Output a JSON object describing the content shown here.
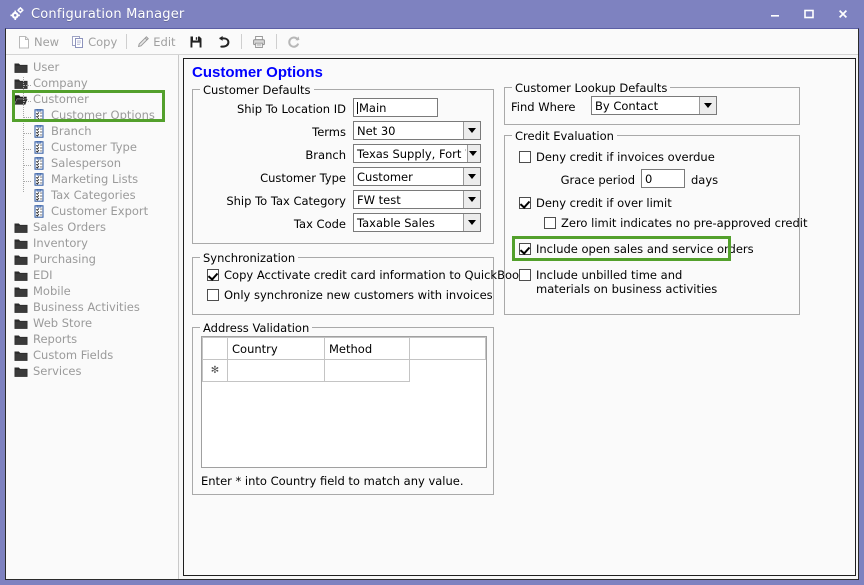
{
  "window": {
    "title": "Configuration Manager",
    "icon": "gear-icon",
    "minimize_label": "–",
    "maximize_label": "☐",
    "close_label": "✕",
    "titlebar_color": "#7e82c0"
  },
  "toolbar": {
    "items": [
      {
        "label": "New",
        "icon": "new-document-icon"
      },
      {
        "label": "Copy",
        "icon": "copy-icon"
      },
      {
        "label": "Edit",
        "icon": "pencil-edit-icon"
      },
      {
        "label": "",
        "icon": "save-disk-icon"
      },
      {
        "label": "",
        "icon": "undo-arrow-icon"
      },
      {
        "label": "",
        "icon": "print-icon"
      },
      {
        "label": "",
        "icon": "refresh-icon"
      }
    ]
  },
  "tree": {
    "items": [
      {
        "label": "User",
        "icon": "folder-icon",
        "level": 0
      },
      {
        "label": "Company",
        "icon": "folder-icon",
        "level": 0
      },
      {
        "label": "Customer",
        "icon": "folder-open-icon",
        "level": 0,
        "expanded": true
      },
      {
        "label": "Customer Options",
        "icon": "options-icon",
        "level": 1,
        "selected": true
      },
      {
        "label": "Branch",
        "icon": "options-icon",
        "level": 1
      },
      {
        "label": "Customer Type",
        "icon": "options-icon",
        "level": 1
      },
      {
        "label": "Salesperson",
        "icon": "options-icon",
        "level": 1
      },
      {
        "label": "Marketing Lists",
        "icon": "options-icon",
        "level": 1
      },
      {
        "label": "Tax Categories",
        "icon": "options-icon",
        "level": 1
      },
      {
        "label": "Customer Export",
        "icon": "options-icon",
        "level": 1
      },
      {
        "label": "Sales Orders",
        "icon": "folder-icon",
        "level": 0
      },
      {
        "label": "Inventory",
        "icon": "folder-icon",
        "level": 0
      },
      {
        "label": "Purchasing",
        "icon": "folder-icon",
        "level": 0
      },
      {
        "label": "EDI",
        "icon": "folder-icon",
        "level": 0
      },
      {
        "label": "Mobile",
        "icon": "folder-icon",
        "level": 0
      },
      {
        "label": "Business Activities",
        "icon": "folder-icon",
        "level": 0
      },
      {
        "label": "Web Store",
        "icon": "folder-icon",
        "level": 0
      },
      {
        "label": "Reports",
        "icon": "folder-icon",
        "level": 0
      },
      {
        "label": "Custom Fields",
        "icon": "folder-icon",
        "level": 0
      },
      {
        "label": "Services",
        "icon": "folder-icon",
        "level": 0
      }
    ],
    "highlight_color": "#53a02c"
  },
  "page": {
    "title": "Customer Options",
    "title_color": "#0000ff"
  },
  "customer_defaults": {
    "legend": "Customer Defaults",
    "ship_to_location_id": {
      "label": "Ship To Location ID",
      "value": "Main"
    },
    "terms": {
      "label": "Terms",
      "value": "Net 30"
    },
    "branch": {
      "label": "Branch",
      "value": "Texas Supply, Fort Worth"
    },
    "customer_type": {
      "label": "Customer Type",
      "value": "Customer"
    },
    "ship_to_tax_category": {
      "label": "Ship To Tax Category",
      "value": "FW test"
    },
    "tax_code": {
      "label": "Tax Code",
      "value": "Taxable Sales"
    }
  },
  "synchronization": {
    "legend": "Synchronization",
    "copy_credit_card": {
      "label": "Copy Acctivate credit card information to QuickBooks",
      "checked": true
    },
    "only_new_customers": {
      "label": "Only synchronize new customers with invoices",
      "checked": false
    }
  },
  "address_validation": {
    "legend": "Address Validation",
    "columns": [
      "",
      "Country",
      "Method",
      ""
    ],
    "rows": [
      {
        "marker": "✻",
        "country": "",
        "method": "",
        "extra": ""
      }
    ],
    "note": "Enter * into Country field to match any value."
  },
  "customer_lookup_defaults": {
    "legend": "Customer Lookup Defaults",
    "find_where": {
      "label": "Find Where",
      "value": "By Contact"
    }
  },
  "credit_evaluation": {
    "legend": "Credit Evaluation",
    "deny_overdue": {
      "label": "Deny credit if invoices overdue",
      "checked": false
    },
    "grace_period": {
      "label": "Grace period",
      "value": "0",
      "suffix": "days"
    },
    "deny_over_limit": {
      "label": "Deny credit if over limit",
      "checked": true
    },
    "zero_limit": {
      "label": "Zero limit indicates no pre-approved credit",
      "checked": false
    },
    "include_open_orders": {
      "label": "Include open sales and service orders",
      "checked": true,
      "highlighted": true
    },
    "include_unbilled": {
      "label": "Include unbilled time and materials on business activities",
      "checked": false
    }
  }
}
